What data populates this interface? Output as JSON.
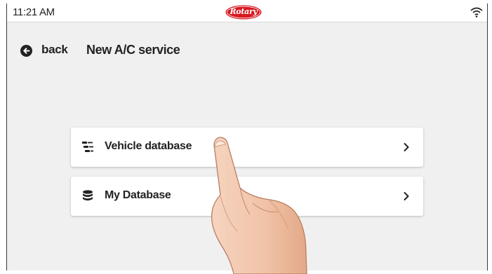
{
  "status_bar": {
    "time": "11:21 AM",
    "logo_text": "Rotary",
    "wifi_icon": "wifi-icon"
  },
  "nav": {
    "back_icon": "arrow-left-circle-icon",
    "back_label": "back",
    "title": "New A/C service"
  },
  "menu": {
    "items": [
      {
        "label": "Vehicle database",
        "icon": "vehicle-list-icon",
        "chevron": "chevron-right-icon"
      },
      {
        "label": "My Database",
        "icon": "database-icon",
        "chevron": "chevron-right-icon"
      }
    ]
  },
  "colors": {
    "background": "#f0f0f0",
    "card": "#ffffff",
    "text": "#222222",
    "brand_red": "#d71920"
  },
  "overlay": {
    "pointer_icon": "pointing-hand-icon"
  }
}
